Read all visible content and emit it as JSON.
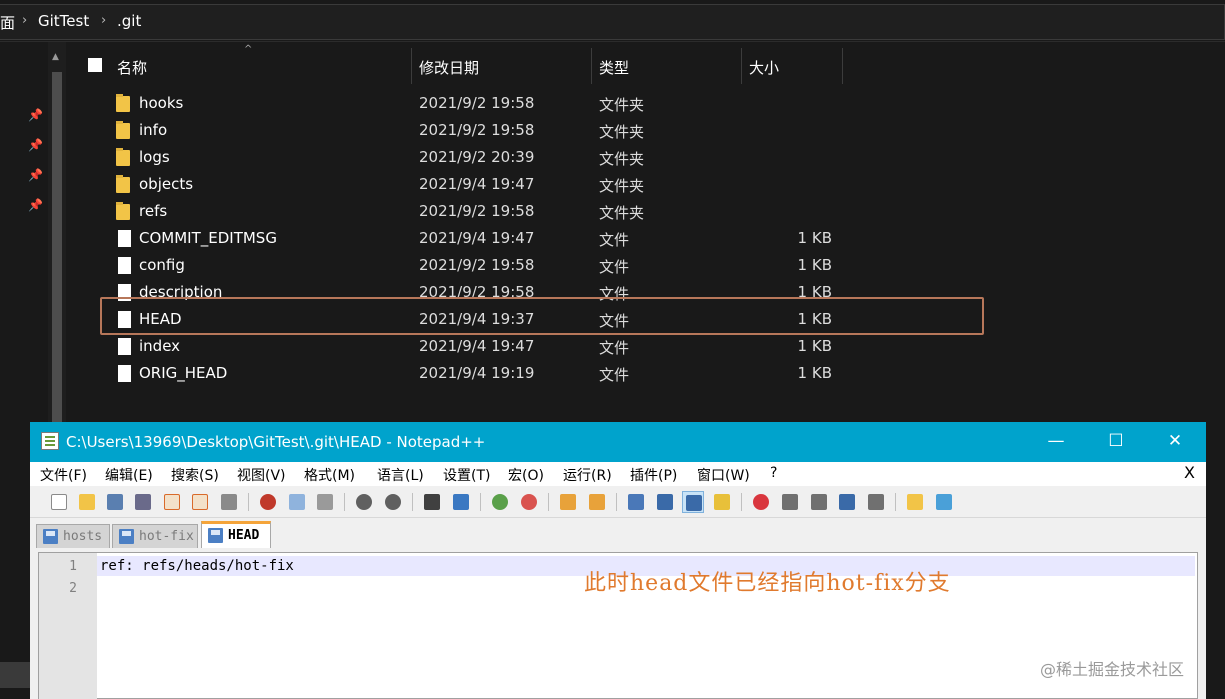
{
  "explorer": {
    "breadcrumb": [
      "面",
      "GitTest",
      ".git"
    ],
    "columns": {
      "name": "名称",
      "date": "修改日期",
      "type": "类型",
      "size": "大小"
    },
    "rows": [
      {
        "name": "hooks",
        "date": "2021/9/2 19:58",
        "type": "文件夹",
        "size": "",
        "kind": "folder"
      },
      {
        "name": "info",
        "date": "2021/9/2 19:58",
        "type": "文件夹",
        "size": "",
        "kind": "folder"
      },
      {
        "name": "logs",
        "date": "2021/9/2 20:39",
        "type": "文件夹",
        "size": "",
        "kind": "folder"
      },
      {
        "name": "objects",
        "date": "2021/9/4 19:47",
        "type": "文件夹",
        "size": "",
        "kind": "folder"
      },
      {
        "name": "refs",
        "date": "2021/9/2 19:58",
        "type": "文件夹",
        "size": "",
        "kind": "folder"
      },
      {
        "name": "COMMIT_EDITMSG",
        "date": "2021/9/4 19:47",
        "type": "文件",
        "size": "1 KB",
        "kind": "file"
      },
      {
        "name": "config",
        "date": "2021/9/2 19:58",
        "type": "文件",
        "size": "1 KB",
        "kind": "file"
      },
      {
        "name": "description",
        "date": "2021/9/2 19:58",
        "type": "文件",
        "size": "1 KB",
        "kind": "file"
      },
      {
        "name": "HEAD",
        "date": "2021/9/4 19:37",
        "type": "文件",
        "size": "1 KB",
        "kind": "file"
      },
      {
        "name": "index",
        "date": "2021/9/4 19:47",
        "type": "文件",
        "size": "1 KB",
        "kind": "file"
      },
      {
        "name": "ORIG_HEAD",
        "date": "2021/9/4 19:19",
        "type": "文件",
        "size": "1 KB",
        "kind": "file"
      }
    ],
    "highlighted_row": "HEAD",
    "highlight_color": "#b7775a"
  },
  "notepad": {
    "title": "C:\\Users\\13969\\Desktop\\GitTest\\.git\\HEAD - Notepad++",
    "window_buttons": {
      "minimize": "—",
      "maximize": "☐",
      "close": "✕"
    },
    "menu": [
      "文件(F)",
      "编辑(E)",
      "搜索(S)",
      "视图(V)",
      "格式(M)",
      "语言(L)",
      "设置(T)",
      "宏(O)",
      "运行(R)",
      "插件(P)",
      "窗口(W)",
      "?"
    ],
    "menu_close": "X",
    "tabs": [
      {
        "label": "hosts",
        "active": false
      },
      {
        "label": "hot-fix",
        "active": false
      },
      {
        "label": "HEAD",
        "active": true
      }
    ],
    "lines": [
      "ref: refs/heads/hot-fix",
      ""
    ],
    "line_numbers": [
      "1",
      "2"
    ],
    "annotation": "此时head文件已经指向hot-fix分支",
    "title_color": "#00a3cc"
  },
  "watermark": "@稀土掘金技术社区"
}
